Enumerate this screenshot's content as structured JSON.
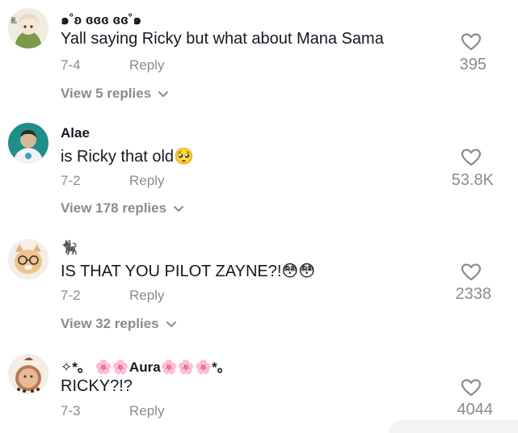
{
  "comments": [
    {
      "username": "๑˚ʚ ɞɞɞ ɞɞ˚๑",
      "text": "Yall saying Ricky but what about Mana Sama",
      "date": "7-4",
      "reply_label": "Reply",
      "likes": "395",
      "view_replies": "View 5 replies"
    },
    {
      "username": "Alae",
      "text": "is Ricky that old🥺",
      "date": "7-2",
      "reply_label": "Reply",
      "likes": "53.8K",
      "view_replies": "View 178 replies"
    },
    {
      "username": "🐈‍⬛",
      "text": "IS THAT YOU PILOT ZAYNE?!😳😳",
      "date": "7-2",
      "reply_label": "Reply",
      "likes": "2338",
      "view_replies": "View 32 replies"
    },
    {
      "username": "✧*。 🌸🌸Aura🌸🌸🌸*。",
      "text": "RICKY?!?",
      "date": "7-3",
      "reply_label": "Reply",
      "likes": "4044"
    }
  ],
  "icons": {
    "like": "heart-outline-icon",
    "expand": "chevron-down-icon"
  },
  "colors": {
    "primary_text": "#161823",
    "secondary_text": "#8a8b91"
  }
}
